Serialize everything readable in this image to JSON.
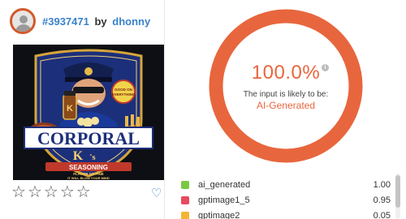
{
  "post": {
    "id": "#3937471",
    "by": "by",
    "author": "dhonny"
  },
  "artwork": {
    "badge": "GOOD ON EVERYTHING",
    "brand_line1": "CORPORAL",
    "brand_k": "K",
    "brand_s": "'s",
    "seasoning": "SEASONING",
    "tagline1": "FLAVOR SO FINE",
    "tagline2": "IT WILL BLOW YOUR MIND"
  },
  "rating": {
    "stars": [
      "☆",
      "☆",
      "☆",
      "☆",
      "☆"
    ],
    "heart": "♡"
  },
  "result": {
    "percent": "100.0%",
    "info": "i",
    "likely": "The input is likely to be:",
    "verdict": "AI-Generated",
    "ring_color": "#e8663d"
  },
  "classes": [
    {
      "name": "ai_generated",
      "score": "1.00",
      "color": "#7ac943"
    },
    {
      "name": "gptimage1_5",
      "score": "0.95",
      "color": "#e84a5f"
    },
    {
      "name": "gptimage2",
      "score": "0.05",
      "color": "#f2b632"
    }
  ]
}
